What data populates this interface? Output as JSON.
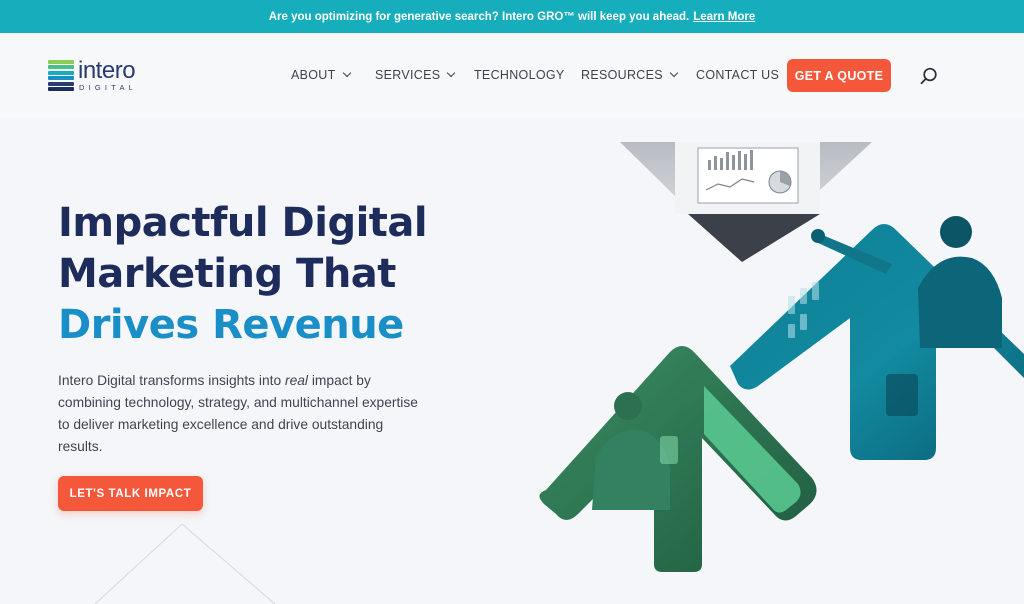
{
  "announcement": {
    "text": "Are you optimizing for generative search? Intero GRO™ will keep you ahead.",
    "link": "Learn More"
  },
  "logo": {
    "word": "intero",
    "sub": "DIGITAL"
  },
  "nav": {
    "about": "ABOUT",
    "services": "SERVICES",
    "technology": "TECHNOLOGY",
    "resources": "RESOURCES",
    "contact": "CONTACT US",
    "quote": "GET A QUOTE"
  },
  "hero": {
    "line1": "Impactful Digital",
    "line2": "Marketing That",
    "line3": "Drives Revenue",
    "desc_before": "Intero Digital transforms insights into ",
    "desc_em": "real",
    "desc_after": " impact by combining technology, strategy, and multichannel expertise to deliver marketing excellence and drive outstanding results.",
    "cta": "LET'S TALK IMPACT"
  },
  "icons": {
    "search": "search-icon",
    "chevron": "chevron-down-icon"
  },
  "colors": {
    "teal": "#16aebd",
    "navy": "#1e2c5c",
    "blue": "#1a8fc7",
    "orange": "#f4573a",
    "green": "#4bbf84"
  }
}
